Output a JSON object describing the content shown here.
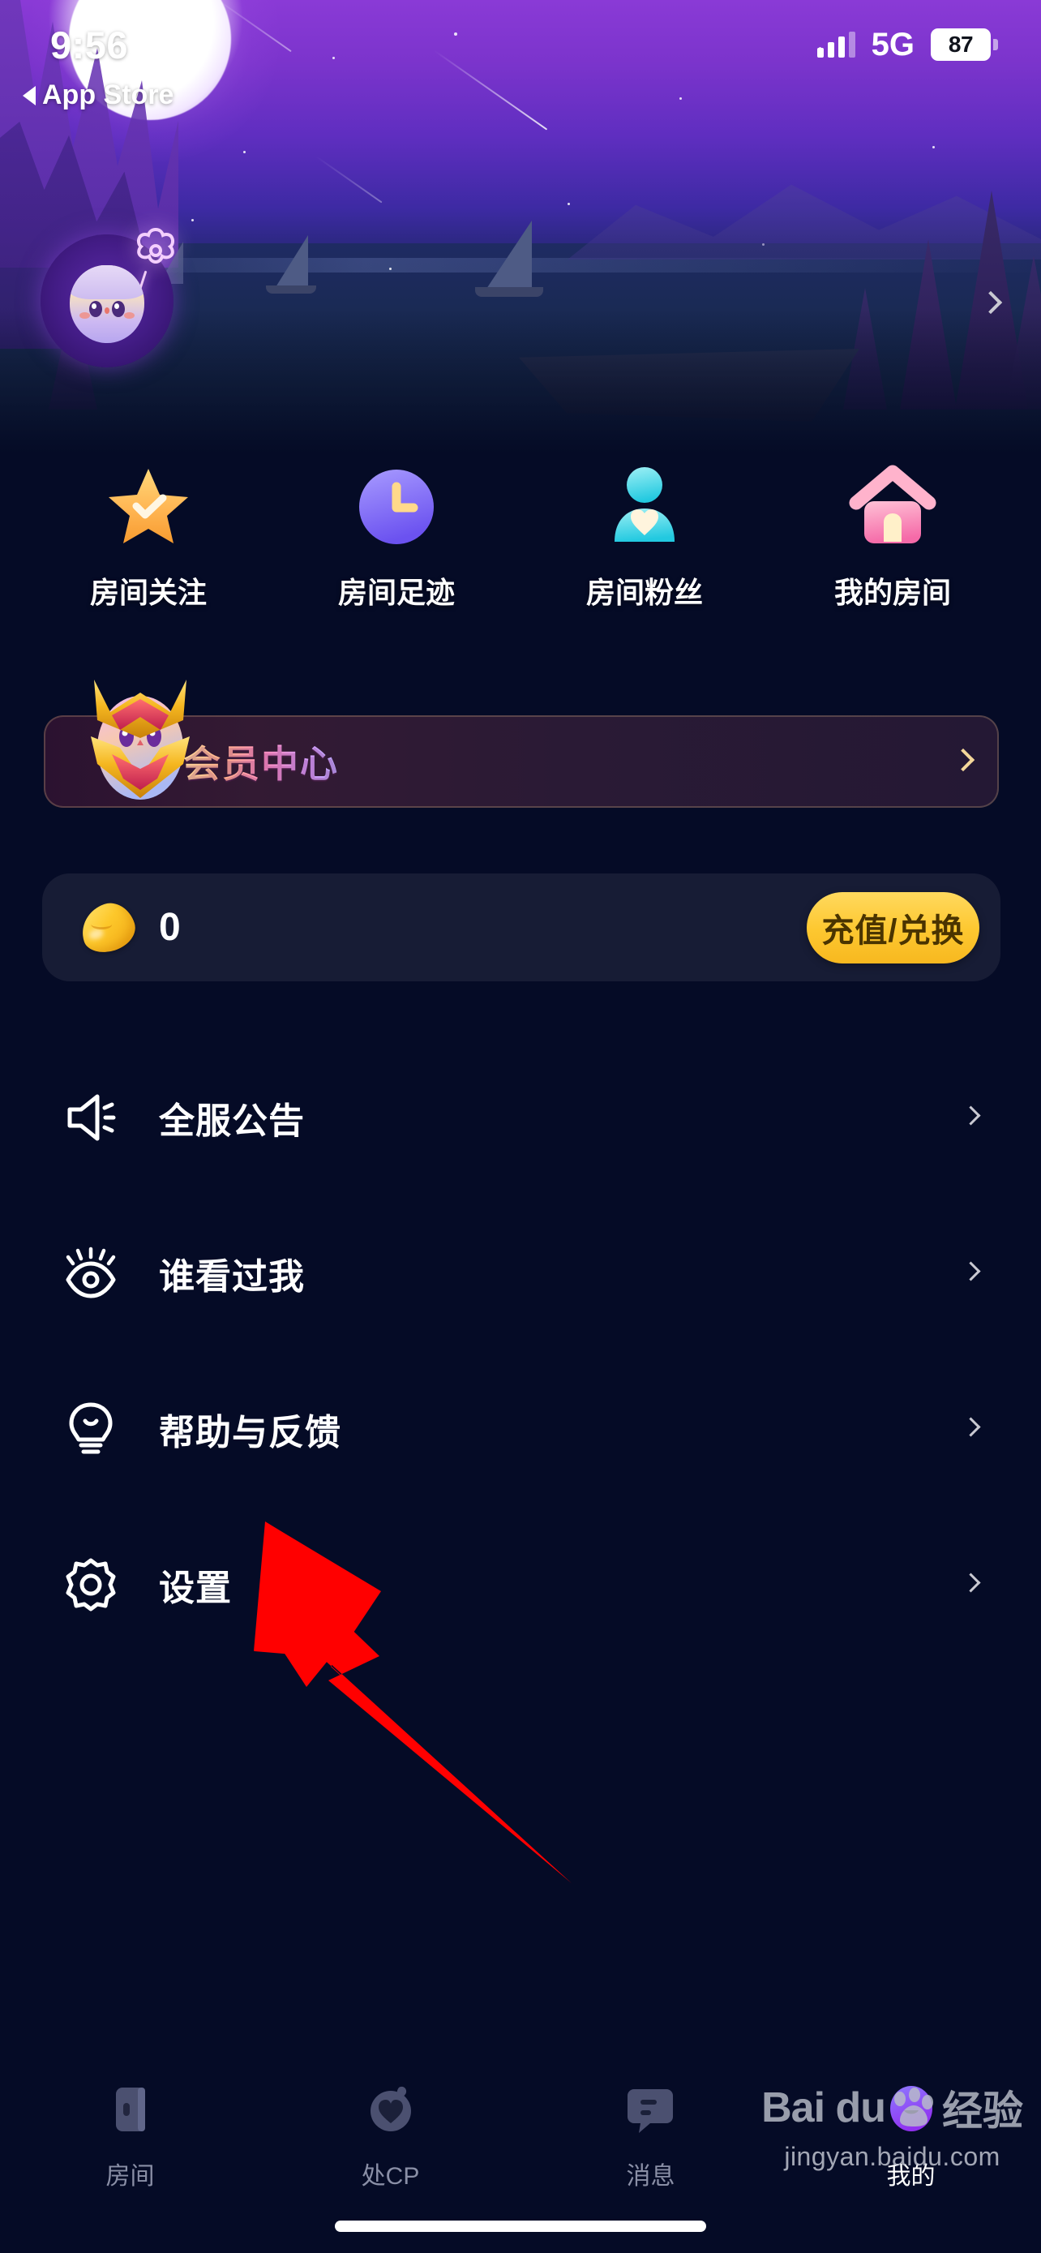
{
  "status_bar": {
    "time": "9:56",
    "network": "5G",
    "battery": "87",
    "signal_icon": "signal-bars-icon",
    "battery_icon": "battery-icon"
  },
  "back_link": {
    "label": "App Store",
    "icon": "back-triangle-icon"
  },
  "profile": {
    "name": "",
    "avatar_icon": "user-avatar",
    "decoration_icon": "flower-balloon-icon",
    "chevron_icon": "chevron-right-icon"
  },
  "quick_actions": [
    {
      "label": "房间关注",
      "icon": "star-check-icon"
    },
    {
      "label": "房间足迹",
      "icon": "clock-icon"
    },
    {
      "label": "房间粉丝",
      "icon": "person-heart-icon"
    },
    {
      "label": "我的房间",
      "icon": "house-icon"
    }
  ],
  "vip_banner": {
    "title": "会员中心",
    "mascot_icon": "crowned-mascot-icon",
    "chevron_icon": "chevron-right-icon"
  },
  "balance": {
    "amount": "0",
    "coin_icon": "gold-bean-icon",
    "button_label": "充值/兑换"
  },
  "menu": [
    {
      "label": "全服公告",
      "icon": "megaphone-icon",
      "chevron": "chevron-right-icon"
    },
    {
      "label": "谁看过我",
      "icon": "eye-icon",
      "chevron": "chevron-right-icon"
    },
    {
      "label": "帮助与反馈",
      "icon": "lightbulb-icon",
      "chevron": "chevron-right-icon"
    },
    {
      "label": "设置",
      "icon": "gear-icon",
      "chevron": "chevron-right-icon"
    }
  ],
  "annotation": {
    "arrow_icon": "red-arrow-pointer",
    "arrow_color": "#FF0000",
    "points_at": "设置"
  },
  "bottom_nav": [
    {
      "label": "房间",
      "icon": "room-icon",
      "active": false
    },
    {
      "label": "处CP",
      "icon": "cp-heart-icon",
      "active": false
    },
    {
      "label": "消息",
      "icon": "message-bubble-icon",
      "active": false
    },
    {
      "label": "我的",
      "icon": "profile-avatar-icon",
      "active": true
    }
  ],
  "watermark": {
    "brand": "Bai du",
    "brand_cn": "经验",
    "url": "jingyan.baidu.com",
    "icon": "baidu-paw-icon"
  },
  "colors": {
    "page_background": "#050B26",
    "accent_gold": "#FDC831",
    "accent_purple": "#7C4DFF",
    "annotation_red": "#FF0000",
    "card_background": "#171C35"
  }
}
